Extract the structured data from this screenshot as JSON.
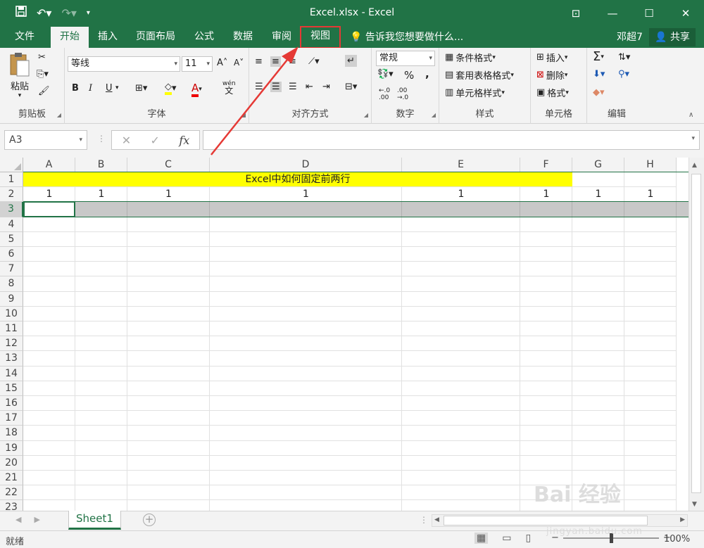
{
  "window": {
    "title": "Excel.xlsx - Excel",
    "min_icon": "minimize-icon",
    "max_icon": "maximize-icon",
    "close_icon": "close-icon"
  },
  "qat": {
    "save_icon": "save-icon",
    "undo_icon": "undo-icon",
    "redo_icon": "redo-icon"
  },
  "tabs": [
    {
      "label": "文件"
    },
    {
      "label": "开始"
    },
    {
      "label": "插入"
    },
    {
      "label": "页面布局"
    },
    {
      "label": "公式"
    },
    {
      "label": "数据"
    },
    {
      "label": "审阅"
    },
    {
      "label": "视图"
    }
  ],
  "tell_me": "告诉我您想要做什么...",
  "user": "邓超7",
  "share": "共享",
  "ribbon": {
    "clipboard": {
      "paste": "粘贴",
      "label": "剪贴板"
    },
    "font": {
      "name": "等线",
      "size": "11",
      "label": "字体",
      "bold": "B",
      "italic": "I",
      "underline": "U",
      "font_color": "A",
      "phonetic": "wén"
    },
    "alignment": {
      "label": "对齐方式"
    },
    "number": {
      "format": "常规",
      "label": "数字",
      "percent": "%",
      "comma": ","
    },
    "styles": {
      "conditional": "条件格式",
      "table": "套用表格格式",
      "cell": "单元格样式",
      "label": "样式"
    },
    "cells": {
      "insert": "插入",
      "delete": "删除",
      "format": "格式",
      "label": "单元格"
    },
    "editing": {
      "label": "编辑",
      "sum": "Σ"
    }
  },
  "formula_bar": {
    "name_box": "A3",
    "fx": "fx",
    "value": ""
  },
  "columns": [
    "A",
    "B",
    "C",
    "D",
    "E",
    "F",
    "G",
    "H"
  ],
  "rows": [
    "1",
    "2",
    "3",
    "4",
    "5",
    "6",
    "7",
    "8",
    "9",
    "10",
    "11",
    "12",
    "13",
    "14",
    "15",
    "16",
    "17",
    "18",
    "19",
    "20",
    "21",
    "22",
    "23"
  ],
  "cells": {
    "row1_title": "Excel中如何固定前两行",
    "row2": [
      "1",
      "1",
      "1",
      "1",
      "1",
      "1",
      "1",
      "1"
    ]
  },
  "sheets": [
    {
      "name": "Sheet1"
    }
  ],
  "add_sheet": "+",
  "status": {
    "text": "就绪",
    "zoom": "100%",
    "minus": "−",
    "plus": "+"
  },
  "colors": {
    "excel_green": "#217346",
    "highlight_yellow": "#ffff00",
    "annotation_red": "#e53935"
  },
  "watermark": {
    "line1": "Bai 经验",
    "line2": "jingyan.baidu.com"
  }
}
